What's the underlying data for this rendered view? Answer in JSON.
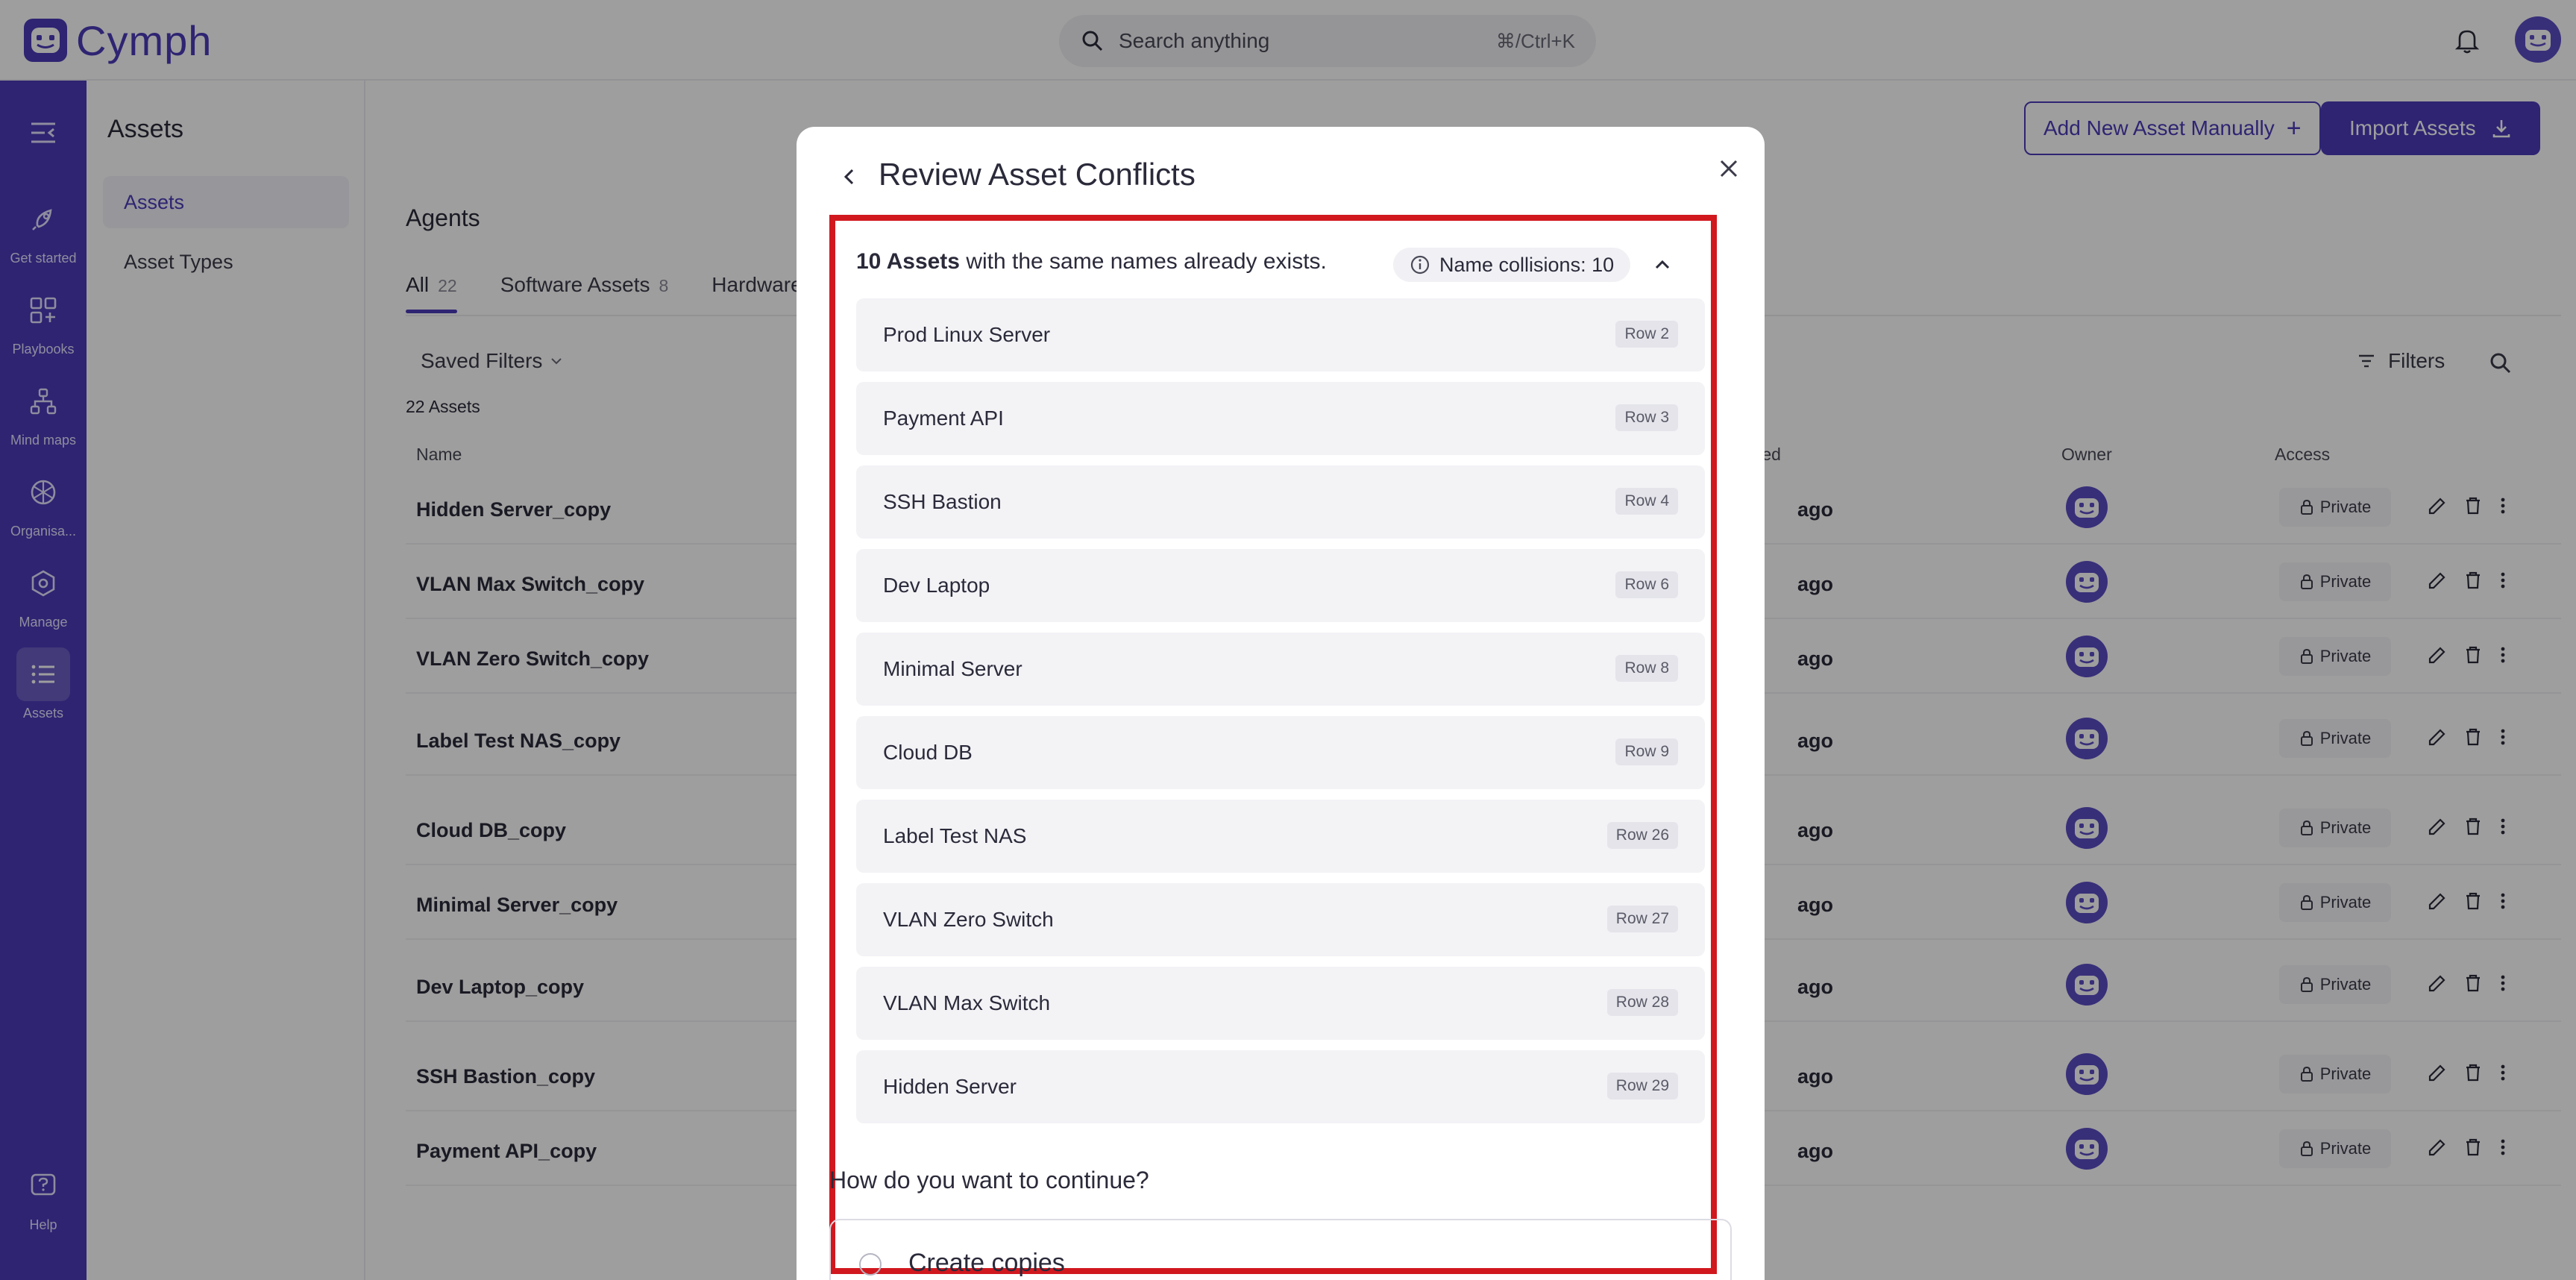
{
  "app": {
    "brand": "Cymph",
    "search_placeholder": "Search anything",
    "search_shortcut": "⌘/Ctrl+K"
  },
  "rail": {
    "items": [
      {
        "label": "Get started",
        "icon": "rocket-icon"
      },
      {
        "label": "Playbooks",
        "icon": "grid-plus-icon"
      },
      {
        "label": "Mind maps",
        "icon": "mind-map-icon"
      },
      {
        "label": "Organisa...",
        "icon": "organisation-icon"
      },
      {
        "label": "Manage",
        "icon": "manage-hex-icon"
      },
      {
        "label": "Assets",
        "icon": "list-icon"
      }
    ],
    "help_label": "Help"
  },
  "subnav": {
    "title": "Assets",
    "items": [
      "Assets",
      "Asset Types"
    ]
  },
  "main": {
    "add_button": "Add New Asset Manually",
    "import_button": "Import Assets",
    "section_title": "Agents",
    "tabs": [
      {
        "label": "All",
        "count": "22"
      },
      {
        "label": "Software Assets",
        "count": "8"
      },
      {
        "label": "Hardware",
        "count": ""
      }
    ],
    "saved_filters": "Saved Filters",
    "asset_count": "22 Assets",
    "filters_label": "Filters",
    "columns": {
      "name": "Name",
      "created": "ted",
      "owner": "Owner",
      "access": "Access"
    },
    "rows": [
      {
        "name": "Hidden Server_copy",
        "created": "ago",
        "access": "Private"
      },
      {
        "name": "VLAN Max Switch_copy",
        "created": "ago",
        "access": "Private"
      },
      {
        "name": "VLAN Zero Switch_copy",
        "created": "ago",
        "access": "Private"
      },
      {
        "name": "Label Test NAS_copy",
        "created": "ago",
        "access": "Private"
      },
      {
        "name": "Cloud DB_copy",
        "created": "ago",
        "access": "Private"
      },
      {
        "name": "Minimal Server_copy",
        "created": "ago",
        "access": "Private"
      },
      {
        "name": "Dev Laptop_copy",
        "created": "ago",
        "access": "Private"
      },
      {
        "name": "SSH Bastion_copy",
        "created": "ago",
        "access": "Private"
      },
      {
        "name": "Payment API_copy",
        "created": "ago",
        "access": "Private"
      }
    ]
  },
  "modal": {
    "title": "Review Asset Conflicts",
    "count_bold": "10 Assets",
    "message_rest": " with the same names already exists.",
    "collisions_label": "Name collisions: 10",
    "conflicts": [
      {
        "name": "Prod Linux Server",
        "row": "Row 2"
      },
      {
        "name": "Payment API",
        "row": "Row 3"
      },
      {
        "name": "SSH Bastion",
        "row": "Row 4"
      },
      {
        "name": "Dev Laptop",
        "row": "Row 6"
      },
      {
        "name": "Minimal Server",
        "row": "Row 8"
      },
      {
        "name": "Cloud DB",
        "row": "Row 9"
      },
      {
        "name": "Label Test NAS",
        "row": "Row 26"
      },
      {
        "name": "VLAN Zero Switch",
        "row": "Row 27"
      },
      {
        "name": "VLAN Max Switch",
        "row": "Row 28"
      },
      {
        "name": "Hidden Server",
        "row": "Row 29"
      }
    ],
    "question": "How do you want to continue?",
    "option_label": "Create copies"
  },
  "colors": {
    "brand": "#4b3bb8",
    "highlight_border": "#d1181f",
    "overlay": "rgba(0,0,0,0.38)"
  }
}
